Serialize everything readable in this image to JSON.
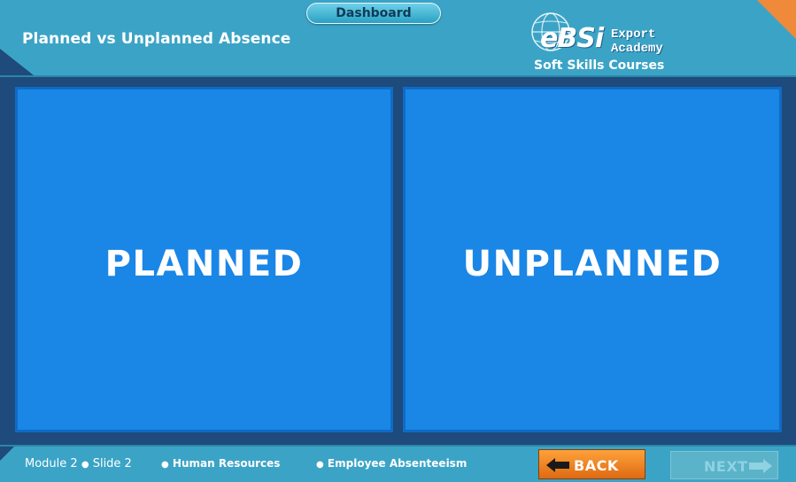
{
  "header": {
    "dashboard_label": "Dashboard",
    "title": "Planned vs Unplanned Absence"
  },
  "logo": {
    "ebsi": "eBSi",
    "export": "Export",
    "academy": "Academy",
    "subtitle": "Soft Skills Courses"
  },
  "panels": [
    {
      "label": "PLANNED"
    },
    {
      "label": "UNPLANNED"
    }
  ],
  "footer": {
    "module": "Module 2",
    "slide": "Slide 2",
    "category": "Human Resources",
    "topic": "Employee Absenteeism",
    "back_label": "BACK",
    "next_label": "NEXT"
  },
  "colors": {
    "header_bg": "#3ba4c6",
    "page_bg": "#1e4a7c",
    "panel_bg": "#1a86e6",
    "back_button": "#f28a2a",
    "corner_accent": "#ef8a3a"
  },
  "icons": {
    "back": "arrow-left-icon",
    "next": "arrow-right-icon",
    "globe": "globe-icon"
  }
}
